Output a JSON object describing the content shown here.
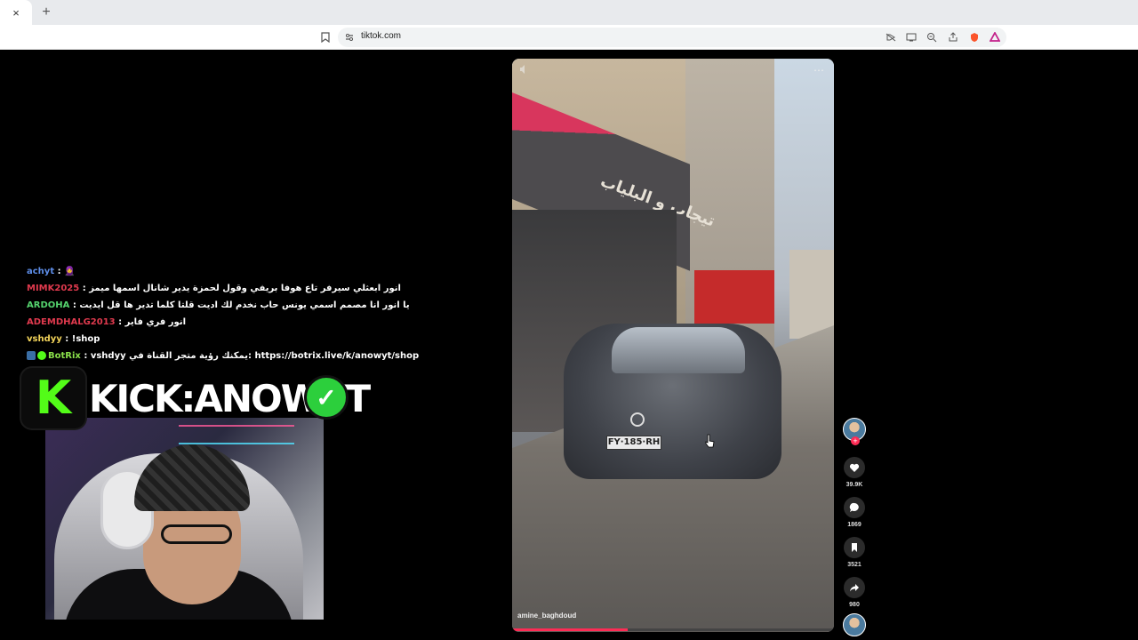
{
  "browser": {
    "tab_close": "×",
    "new_tab": "+",
    "url": "tiktok.com"
  },
  "video": {
    "username": "amine_baghdoud",
    "plate": "FY·185·RH",
    "shop_sign": "تيجاب و البلياب",
    "progress": 0.36
  },
  "actions": {
    "likes": "39.9K",
    "comments": "1869",
    "saves": "3521",
    "shares": "980"
  },
  "chat": [
    {
      "user": "achyt",
      "color": "blue",
      "message": "🧕"
    },
    {
      "user": "MIMK2025",
      "color": "red",
      "message": "انور ابعثلي سيرفر تاع هوفا بريفي وقول لحمزة يدير شانال اسمها ميمز"
    },
    {
      "user": "ARDOHA",
      "color": "green",
      "message": "يا انور انا مصمم اسمي يونس حاب نخدم لك اديت قلتا كلما تدير ها قل ايديت"
    },
    {
      "user": "ADEMDHALG2013",
      "color": "red",
      "message": "انور فري فاير"
    },
    {
      "user": "vshdyy",
      "color": "yellow",
      "message": "!shop"
    },
    {
      "user": "BotRix",
      "color": "botrix",
      "message": "vshdyy يمكنك رؤية متجر القناة في: https://botrix.live/k/anowyt/shop"
    }
  ],
  "kick": {
    "logo_letter": "K",
    "banner_text": "KICK:ANOWYT",
    "verified_mark": "✓"
  },
  "colors": {
    "kick_green": "#53fc18",
    "tiktok_red": "#fe2c55"
  }
}
